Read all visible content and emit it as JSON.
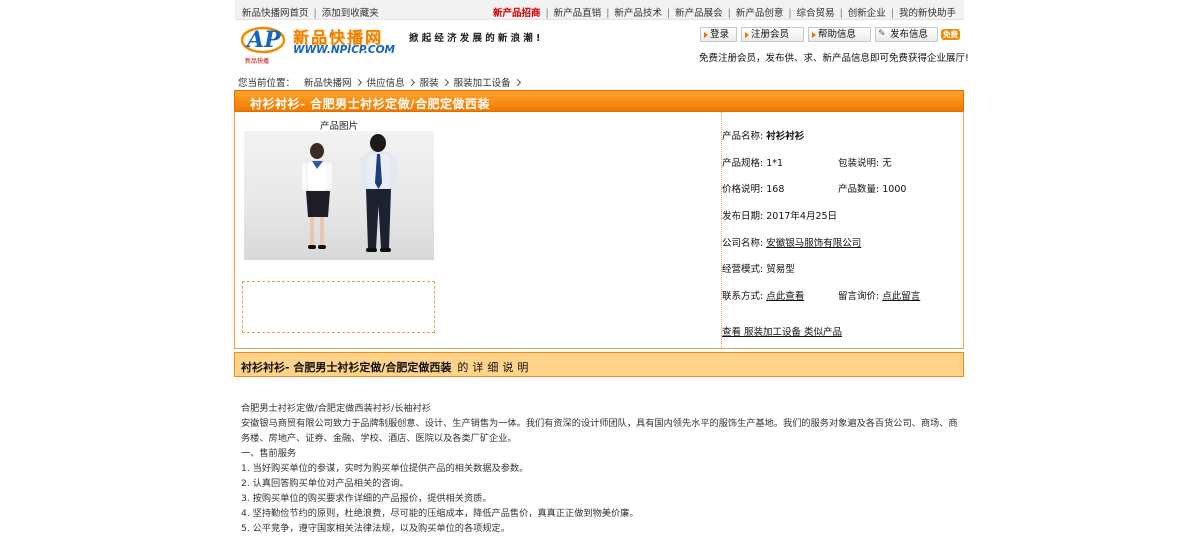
{
  "topbar": {
    "home": "新品快播网首页",
    "favorite": "添加到收藏夹",
    "links": [
      "新产品招商",
      "新产品直销",
      "新产品技术",
      "新产品展会",
      "新产品创意",
      "综合贸易",
      "创新企业",
      "我的新快助手"
    ]
  },
  "logo": {
    "brand": "新品快播网",
    "url": "WWW.NPICP.COM",
    "mini": "新品快播"
  },
  "slogan": "掀起经济发展的新浪潮!",
  "actions": {
    "login": "登录",
    "register": "注册会员",
    "help": "帮助信息",
    "publish": "发布信息",
    "free": "免费",
    "note": "免费注册会员，发布供、求、新产品信息即可免费获得企业展厅!"
  },
  "breadcrumb": {
    "prefix": "您当前位置：",
    "items": [
      "新品快播网",
      "供应信息",
      "服装",
      "服装加工设备"
    ]
  },
  "product": {
    "title": "衬衫衬衫- 合肥男士衬衫定做/合肥定做西装",
    "pic_label": "产品图片",
    "name_label": "产品名称:",
    "name": "衬衫衬衫",
    "spec_label": "产品规格:",
    "spec": "1*1",
    "pack_label": "包装说明:",
    "pack": "无",
    "price_label": "价格说明:",
    "price": "168",
    "qty_label": "产品数量:",
    "qty": "1000",
    "date_label": "发布日期:",
    "date": "2017年4月25日",
    "company_label": "公司名称:",
    "company": "安徽银马服饰有限公司",
    "mode_label": "经营模式:",
    "mode": "贸易型",
    "contact_label": "联系方式:",
    "contact": "点此查看",
    "inquiry_label": "留言询价:",
    "inquiry": "点此留言",
    "similar": "查看 服装加工设备 类似产品"
  },
  "detail": {
    "title": "衬衫衬衫- 合肥男士衬衫定做/合肥定做西装",
    "suffix": "的详细说明",
    "lines": [
      "合肥男士衬衫定做/合肥定做西装衬衫/长袖衬衫",
      "安徽银马商贸有限公司致力于品牌制服创意、设计、生产销售为一体。我们有资深的设计师团队，具有国内领先水平的服饰生产基地。我们的服务对象遍及各百货公司、商场、商务楼、房地产、证券、金融、学校、酒店、医院以及各类厂矿企业。",
      "一、售前服务",
      "1. 当好购买单位的参谋，实时为购买单位提供产品的相关数据及参数。",
      "2. 认真回答购买单位对产品相关的咨询。",
      "3. 按购买单位的购买要求作详细的产品报价，提供相关资质。",
      "4. 坚持勤俭节约的原则，杜绝浪费，尽可能的压缩成本，降低产品售价，真真正正做到物美价廉。",
      "5. 公平竞争，遵守国家相关法律法规，以及购买单位的各项规定。"
    ]
  },
  "colors": {
    "accent": "#f07a00",
    "hot": "#d40000",
    "detail_bg": "#ffd389"
  }
}
